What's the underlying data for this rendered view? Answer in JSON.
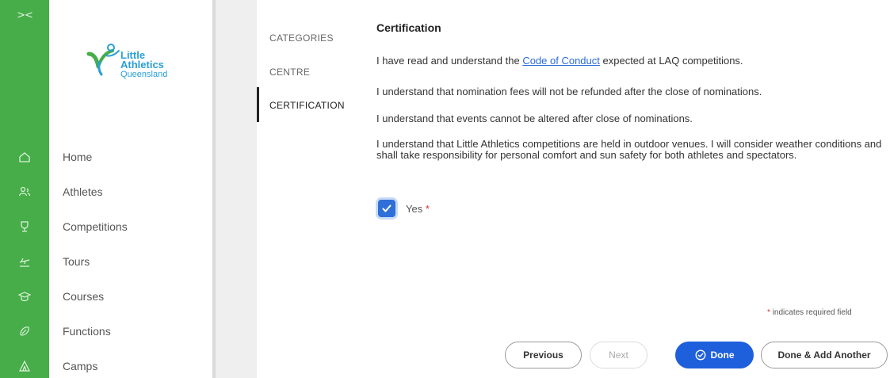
{
  "rail": {
    "collapse_glyph": "><"
  },
  "logo": {
    "line1": "Little",
    "line2": "Athletics",
    "line3": "Queensland"
  },
  "nav": [
    {
      "label": "Home",
      "icon": "home-icon"
    },
    {
      "label": "Athletes",
      "icon": "users-icon"
    },
    {
      "label": "Competitions",
      "icon": "trophy-icon"
    },
    {
      "label": "Tours",
      "icon": "plane-icon"
    },
    {
      "label": "Courses",
      "icon": "graduation-icon"
    },
    {
      "label": "Functions",
      "icon": "tag-icon"
    },
    {
      "label": "Camps",
      "icon": "tent-icon"
    }
  ],
  "steps": [
    {
      "label": "CATEGORIES"
    },
    {
      "label": "CENTRE"
    },
    {
      "label": "CERTIFICATION"
    }
  ],
  "form": {
    "title": "Certification",
    "p1_before": "I have read and understand the ",
    "p1_link": "Code of Conduct",
    "p1_after": " expected at LAQ competitions.",
    "p2": "I understand that nomination fees will not be refunded after the close of nominations.",
    "p3": "I understand that events cannot be altered after close of nominations.",
    "p4": "I understand that Little Athletics competitions are held in outdoor venues.  I will consider weather conditions and shall take responsibility for personal comfort and sun safety for both athletes and spectators.",
    "checkbox_label": "Yes",
    "required_mark": "*",
    "required_note": "indicates required field"
  },
  "buttons": {
    "previous": "Previous",
    "next": "Next",
    "done": "Done",
    "done_add": "Done & Add Another"
  },
  "colors": {
    "rail": "#46ad48",
    "primary": "#1e5fdc",
    "link": "#2a6bd6",
    "required": "#d9342b"
  }
}
